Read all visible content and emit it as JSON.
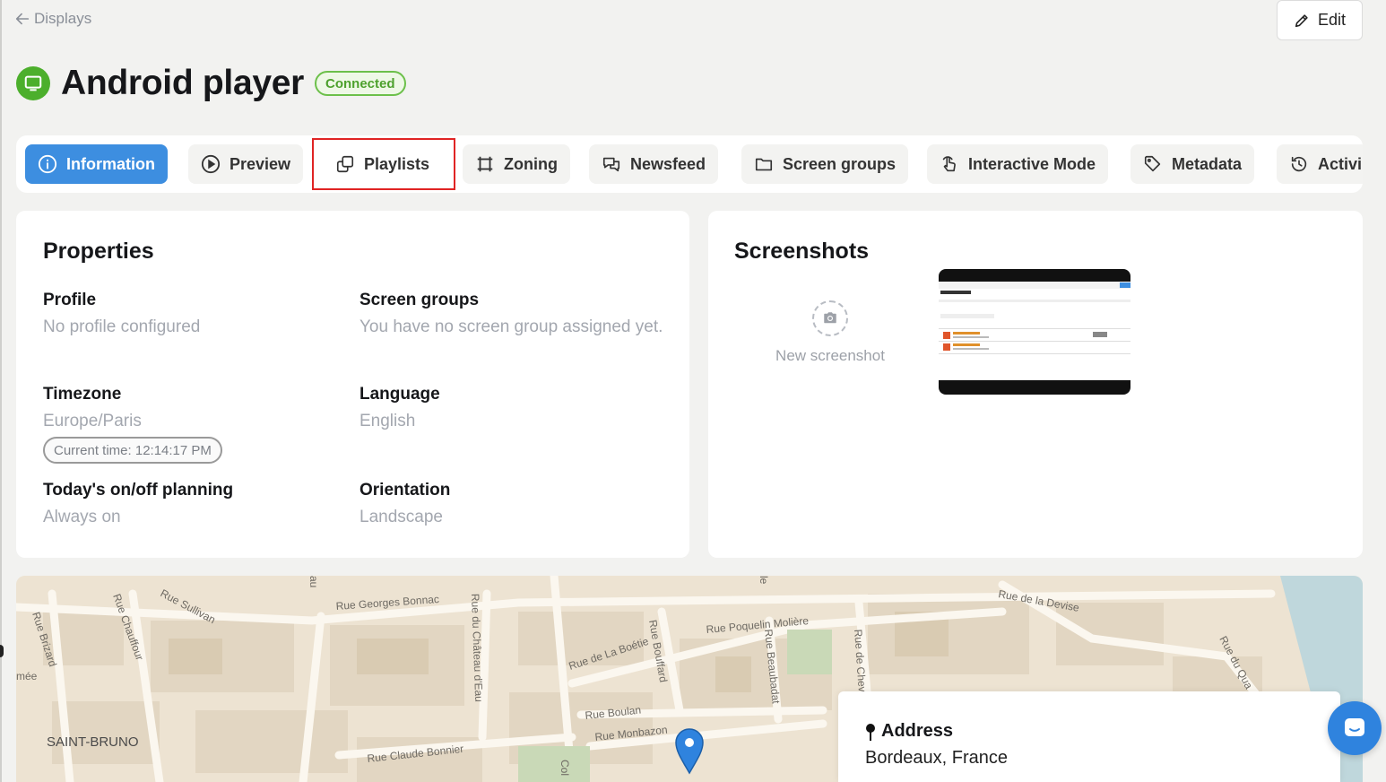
{
  "nav": {
    "back_label": "Displays",
    "edit_label": "Edit"
  },
  "header": {
    "title": "Android player",
    "status": "Connected",
    "status_color": "#4da12d"
  },
  "tabs": [
    {
      "label": "Information",
      "icon": "info-icon",
      "active": true
    },
    {
      "label": "Preview",
      "icon": "play-icon"
    },
    {
      "label": "Playlists",
      "icon": "copy-icon",
      "highlighted": true
    },
    {
      "label": "Zoning",
      "icon": "frame-icon"
    },
    {
      "label": "Newsfeed",
      "icon": "chat-bubbles-icon"
    },
    {
      "label": "Screen groups",
      "icon": "folder-icon"
    },
    {
      "label": "Interactive Mode",
      "icon": "touch-icon"
    },
    {
      "label": "Metadata",
      "icon": "tag-icon"
    },
    {
      "label": "Activi",
      "icon": "history-icon"
    }
  ],
  "properties": {
    "title": "Properties",
    "profile": {
      "label": "Profile",
      "value": "No profile configured"
    },
    "screen_groups": {
      "label": "Screen groups",
      "value": "You have no screen group assigned yet."
    },
    "timezone": {
      "label": "Timezone",
      "value": "Europe/Paris",
      "current_time": "Current time: 12:14:17 PM"
    },
    "language": {
      "label": "Language",
      "value": "English"
    },
    "planning": {
      "label": "Today's on/off planning",
      "value": "Always on"
    },
    "orientation": {
      "label": "Orientation",
      "value": "Landscape"
    }
  },
  "screenshots": {
    "title": "Screenshots",
    "new_label": "New screenshot"
  },
  "map": {
    "streets": [
      "Rue Georges Bonnac",
      "Rue Sullivan",
      "Rue Chauffour",
      "Rue Brizard",
      "Rue du Château d'Eau",
      "Rue de La Boétie",
      "Rue Bouffard",
      "Rue Poquelin Molière",
      "Rue Beaubadat",
      "Rue de Chev",
      "Rue de la Devise",
      "Rue du Qua",
      "Rue Boulan",
      "Rue Monbazon",
      "Rue Claude Bonnier",
      "SAINT-BRUNO",
      "mée",
      "au",
      "le",
      "Col"
    ]
  },
  "address": {
    "label": "Address",
    "value": "Bordeaux, France"
  },
  "colors": {
    "accent": "#3d8ee0",
    "highlight_border": "#e02424",
    "connected_green": "#4caf2c"
  }
}
